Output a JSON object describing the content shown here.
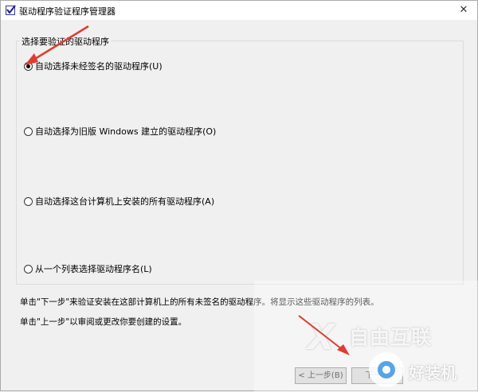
{
  "window": {
    "title": "驱动程序验证程序管理器",
    "close_glyph": "✕"
  },
  "group": {
    "title": "选择要验证的驱动程序"
  },
  "options": [
    {
      "label": "自动选择未经签名的驱动程序(U)",
      "checked": true
    },
    {
      "label": "自动选择为旧版 Windows 建立的驱动程序(O)",
      "checked": false
    },
    {
      "label": "自动选择这台计算机上安装的所有驱动程序(A)",
      "checked": false
    },
    {
      "label": "从一个列表选择驱动程序名(L)",
      "checked": false
    }
  ],
  "info": {
    "line1": "单击\"下一步\"来验证安装在这部计算机上的所有未签名的驱动程序。将显示这些驱动程序的列表。",
    "line2": "单击\"上一步\"以审阅或更改你要创建的设置。"
  },
  "buttons": {
    "back": "< 上一步(B)",
    "next": "下一步"
  },
  "watermark": {
    "brand1": "自由互联",
    "mark1": "X",
    "brand2": "好装机"
  },
  "colors": {
    "arrow": "#e03c31",
    "titlebar": "#ffffff",
    "background": "#f0f0f0"
  }
}
